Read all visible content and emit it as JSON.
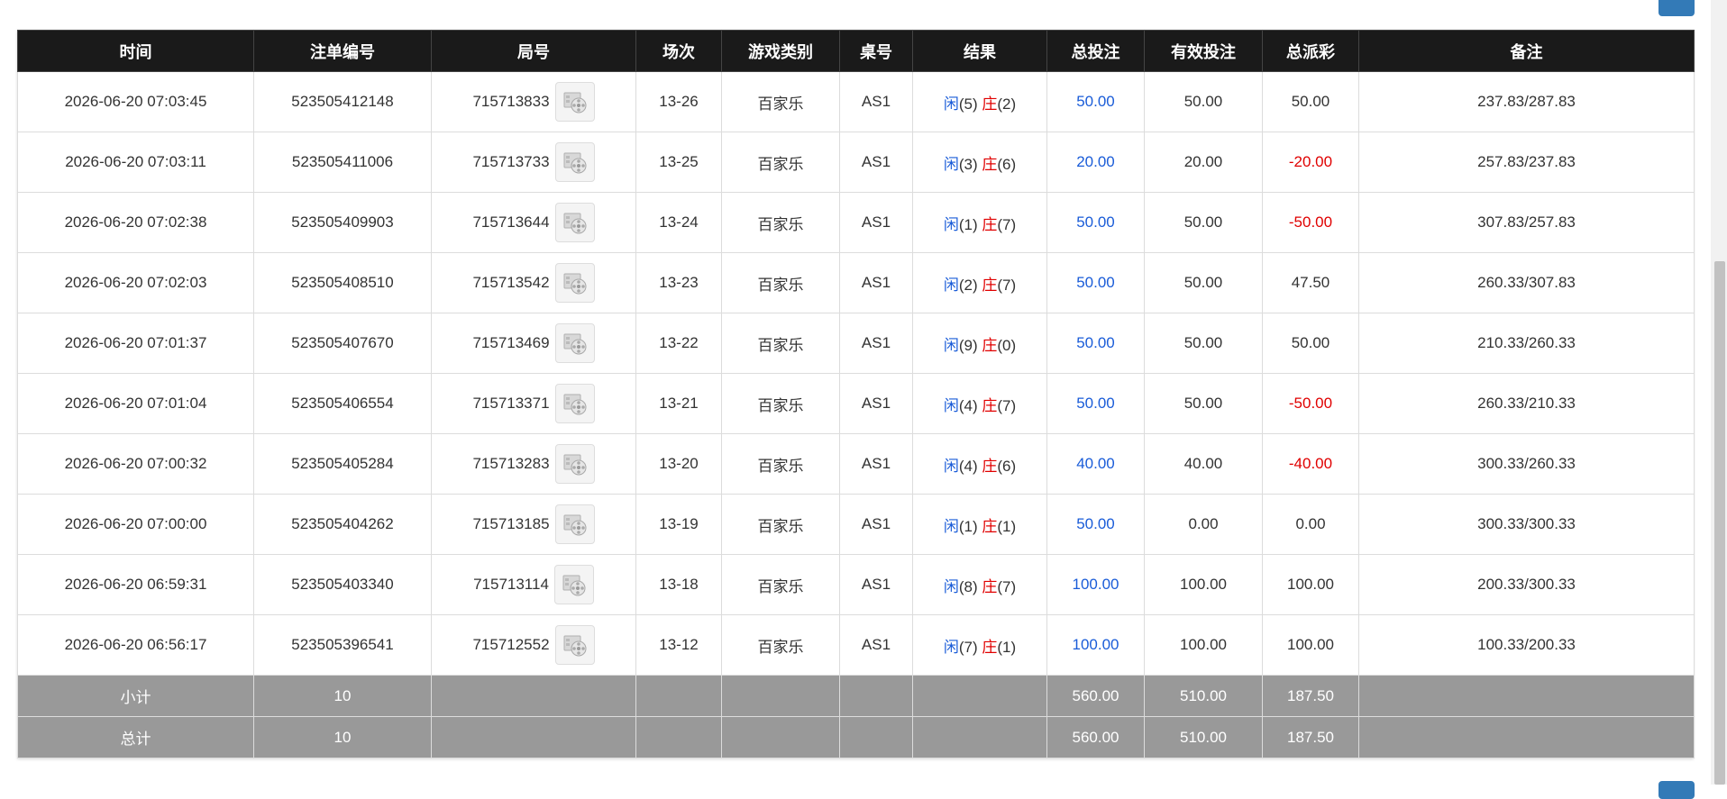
{
  "table": {
    "headers": [
      "时间",
      "注单编号",
      "局号",
      "场次",
      "游戏类别",
      "桌号",
      "结果",
      "总投注",
      "有效投注",
      "总派彩",
      "备注"
    ],
    "rows": [
      {
        "time": "2026-06-20 07:03:45",
        "bet_id": "523505412148",
        "round": "715713833",
        "shoe": "13-26",
        "game": "百家乐",
        "table": "AS1",
        "player_label": "闲",
        "player_score": "(5)",
        "banker_label": "庄",
        "banker_score": "(2)",
        "total_bet": "50.00",
        "valid_bet": "50.00",
        "payout": "50.00",
        "payout_negative": false,
        "remark": "237.83/287.83"
      },
      {
        "time": "2026-06-20 07:03:11",
        "bet_id": "523505411006",
        "round": "715713733",
        "shoe": "13-25",
        "game": "百家乐",
        "table": "AS1",
        "player_label": "闲",
        "player_score": "(3)",
        "banker_label": "庄",
        "banker_score": "(6)",
        "total_bet": "20.00",
        "valid_bet": "20.00",
        "payout": "-20.00",
        "payout_negative": true,
        "remark": "257.83/237.83"
      },
      {
        "time": "2026-06-20 07:02:38",
        "bet_id": "523505409903",
        "round": "715713644",
        "shoe": "13-24",
        "game": "百家乐",
        "table": "AS1",
        "player_label": "闲",
        "player_score": "(1)",
        "banker_label": "庄",
        "banker_score": "(7)",
        "total_bet": "50.00",
        "valid_bet": "50.00",
        "payout": "-50.00",
        "payout_negative": true,
        "remark": "307.83/257.83"
      },
      {
        "time": "2026-06-20 07:02:03",
        "bet_id": "523505408510",
        "round": "715713542",
        "shoe": "13-23",
        "game": "百家乐",
        "table": "AS1",
        "player_label": "闲",
        "player_score": "(2)",
        "banker_label": "庄",
        "banker_score": "(7)",
        "total_bet": "50.00",
        "valid_bet": "50.00",
        "payout": "47.50",
        "payout_negative": false,
        "remark": "260.33/307.83"
      },
      {
        "time": "2026-06-20 07:01:37",
        "bet_id": "523505407670",
        "round": "715713469",
        "shoe": "13-22",
        "game": "百家乐",
        "table": "AS1",
        "player_label": "闲",
        "player_score": "(9)",
        "banker_label": "庄",
        "banker_score": "(0)",
        "total_bet": "50.00",
        "valid_bet": "50.00",
        "payout": "50.00",
        "payout_negative": false,
        "remark": "210.33/260.33"
      },
      {
        "time": "2026-06-20 07:01:04",
        "bet_id": "523505406554",
        "round": "715713371",
        "shoe": "13-21",
        "game": "百家乐",
        "table": "AS1",
        "player_label": "闲",
        "player_score": "(4)",
        "banker_label": "庄",
        "banker_score": "(7)",
        "total_bet": "50.00",
        "valid_bet": "50.00",
        "payout": "-50.00",
        "payout_negative": true,
        "remark": "260.33/210.33"
      },
      {
        "time": "2026-06-20 07:00:32",
        "bet_id": "523505405284",
        "round": "715713283",
        "shoe": "13-20",
        "game": "百家乐",
        "table": "AS1",
        "player_label": "闲",
        "player_score": "(4)",
        "banker_label": "庄",
        "banker_score": "(6)",
        "total_bet": "40.00",
        "valid_bet": "40.00",
        "payout": "-40.00",
        "payout_negative": true,
        "remark": "300.33/260.33"
      },
      {
        "time": "2026-06-20 07:00:00",
        "bet_id": "523505404262",
        "round": "715713185",
        "shoe": "13-19",
        "game": "百家乐",
        "table": "AS1",
        "player_label": "闲",
        "player_score": "(1)",
        "banker_label": "庄",
        "banker_score": "(1)",
        "total_bet": "50.00",
        "valid_bet": "0.00",
        "payout": "0.00",
        "payout_negative": false,
        "remark": "300.33/300.33"
      },
      {
        "time": "2026-06-20 06:59:31",
        "bet_id": "523505403340",
        "round": "715713114",
        "shoe": "13-18",
        "game": "百家乐",
        "table": "AS1",
        "player_label": "闲",
        "player_score": "(8)",
        "banker_label": "庄",
        "banker_score": "(7)",
        "total_bet": "100.00",
        "valid_bet": "100.00",
        "payout": "100.00",
        "payout_negative": false,
        "remark": "200.33/300.33"
      },
      {
        "time": "2026-06-20 06:56:17",
        "bet_id": "523505396541",
        "round": "715712552",
        "shoe": "13-12",
        "game": "百家乐",
        "table": "AS1",
        "player_label": "闲",
        "player_score": "(7)",
        "banker_label": "庄",
        "banker_score": "(1)",
        "total_bet": "100.00",
        "valid_bet": "100.00",
        "payout": "100.00",
        "payout_negative": false,
        "remark": "100.33/200.33"
      }
    ],
    "subtotal": {
      "label": "小计",
      "count": "10",
      "total_bet": "560.00",
      "valid_bet": "510.00",
      "payout": "187.50"
    },
    "total": {
      "label": "总计",
      "count": "10",
      "total_bet": "560.00",
      "valid_bet": "510.00",
      "payout": "187.50"
    }
  },
  "colors": {
    "header_bg": "#1a1a1a",
    "summary_bg": "#999999",
    "link_blue": "#1a5cd8",
    "negative_red": "#e00000",
    "button_blue": "#337ab7"
  },
  "icons": {
    "round_video": "video-replay-icon"
  }
}
